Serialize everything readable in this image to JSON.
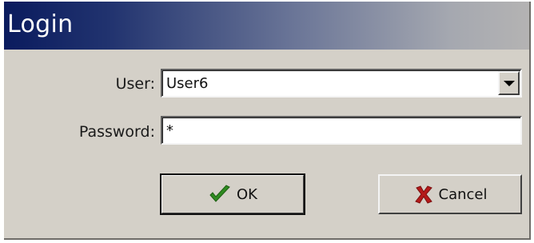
{
  "window": {
    "title": "Login"
  },
  "form": {
    "user_label": "User:",
    "user_value": "User6",
    "password_label": "Password:",
    "password_value": "*"
  },
  "buttons": {
    "ok_label": "OK",
    "cancel_label": "Cancel"
  },
  "icons": {
    "dropdown": "chevron-down-icon",
    "ok": "checkmark-icon",
    "cancel": "x-icon"
  },
  "colors": {
    "ok_icon": "#2e8b20",
    "cancel_icon": "#b51a1a",
    "titlebar_start": "#0a1b5e"
  }
}
